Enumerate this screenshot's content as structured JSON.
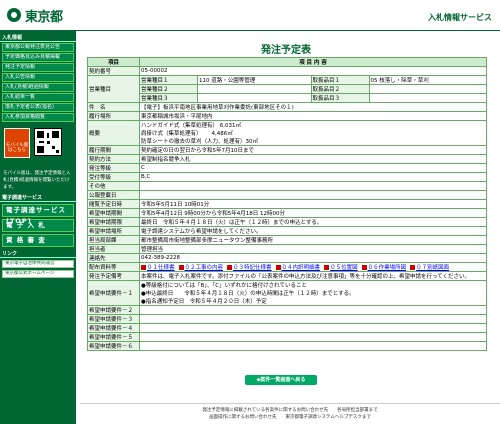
{
  "header": {
    "logo": "東京都",
    "service": "入札情報サービス"
  },
  "sidebar": {
    "sec1": "入札情報",
    "items": [
      "東京都公報発注表見公告",
      "予定価格見込み見積掲載",
      "発注予定情報",
      "入札公告情報",
      "入札(見積)経過情報",
      "入札結果一覧",
      "落札予定者公表(指名)",
      "入札参加資格閲覧"
    ],
    "mobile_btn": "モバイル版はこちら",
    "mobile_text": "モバイル版は、発注予定情報と入札(見積)経過情報を閲覧いただけます。",
    "sec2": "電子調達サービス",
    "big": [
      "電子調達サービス(TOP)",
      "電 子 入 札",
      "資 格 審 査"
    ],
    "sec3": "リンク",
    "links": [
      "東京電子自治体共同運営",
      "東京都公式ホームページ"
    ]
  },
  "page_title": "発注予定表",
  "table": {
    "h_item": "項目",
    "h_content": "項 目 内 容",
    "rows": [
      {
        "k": "契約番号",
        "v": "05-00002"
      },
      {
        "k": "営業種目",
        "sub": [
          "営業種目１",
          "営業種目２",
          "営業種目３"
        ],
        "vals": [
          "110 道路・公園等管理",
          "",
          ""
        ],
        "sub2": [
          "取扱品目１",
          "取扱品目２",
          "取扱品目３"
        ],
        "vals2": [
          "05 枝落し・除草・草刈",
          "",
          ""
        ]
      },
      {
        "k": "件　名",
        "v": "【電子】板浜平南地区事業用地草刈作業委託(東部地区その１)"
      },
      {
        "k": "履行場所",
        "v": "東京都稲城市坂浜・平尾地内"
      },
      {
        "k": "概要",
        "v": [
          "ハンドガイド式（集草処理有） 6,031㎡",
          "肩掛け式（集草処理有）　　 4,486㎡",
          "防草シートの撤去の草刈（人力、処理有）30㎡"
        ]
      },
      {
        "k": "履行期間",
        "v": "契約確定の日の翌日から令和5年7月10日まで"
      },
      {
        "k": "契約方法",
        "v": "希望制指名競争入札"
      },
      {
        "k": "発注等級",
        "v": "C"
      },
      {
        "k": "受付等級",
        "v": "B,C"
      },
      {
        "k": "その他",
        "v": ""
      },
      {
        "k": "公報登載日",
        "v": ""
      },
      {
        "k": "閲覧予定日時",
        "v": "令和5年5月11日 10時01分"
      },
      {
        "k": "希望申請期間",
        "v": "令和5年4月12日 9時00分から令和5年4月18日 12時00分"
      },
      {
        "k": "希望申請期限",
        "v": "最終日　令和５年４月１８日（火）は正午（１２時）までの申込とする。"
      },
      {
        "k": "希望申請場所",
        "v": "電子調達システムから希望申請をしてください。"
      },
      {
        "k": "担当局部課",
        "v": "都市整備局市街地整備部多摩ニュータウン整備事務所"
      },
      {
        "k": "担当者",
        "v": "管理担当"
      },
      {
        "k": "連絡先",
        "v": "042-389-2228"
      },
      {
        "k": "配布資料等",
        "files": [
          "０１仕様書",
          "０２工事の内容",
          "０３特記仕様書",
          "０４内訳明細書",
          "０５位置図",
          "０６作業場所図",
          "０７別紙図面"
        ]
      },
      {
        "k": "発注予定備考",
        "v": [
          "本案件は、電子入札案件です。添付ファイルの「公表案件の申込方法及び注意事項」等を十分確認の上、希望申請を行ってください。"
        ]
      },
      {
        "k": "希望申請要件－１",
        "v": [
          "●等級格付については「B」、「C」いずれかに格付けされていること",
          "●申込最終日　　令和５年４月１８日（火）の申込時間は正午（１２時）までとする。",
          "●指名通知予定日　令和５年４月２０日（木）予定"
        ]
      },
      {
        "k": "希望申請要件－２",
        "v": ""
      },
      {
        "k": "希望申請要件－３",
        "v": ""
      },
      {
        "k": "希望申請要件－４",
        "v": ""
      },
      {
        "k": "希望申請要件－５",
        "v": ""
      },
      {
        "k": "希望申請要件－６",
        "v": ""
      }
    ]
  },
  "back_button": "◆案件一覧画面へ戻る",
  "footer": [
    "発注予定情報に掲載されている各案件に関するお問い合わせ先　　各局所担当部署まで",
    "画面操作に関するお問い合わせ先　　東京都電子調達システムヘルプデスクまで"
  ]
}
